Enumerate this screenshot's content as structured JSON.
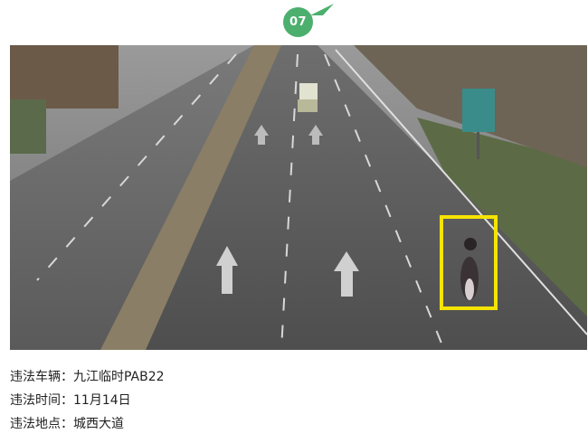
{
  "badge": {
    "number": "07"
  },
  "photo": {
    "description_icon": "road-traffic-camera-photo",
    "highlight_color": "#f5e400"
  },
  "info": {
    "vehicle": {
      "label": "违法车辆：",
      "value": "九江临时PAB22"
    },
    "time": {
      "label": "违法时间：",
      "value": "11月14日"
    },
    "location": {
      "label": "违法地点：",
      "value": "城西大道"
    }
  },
  "colors": {
    "accent": "#4caf6e",
    "text": "#222222"
  }
}
